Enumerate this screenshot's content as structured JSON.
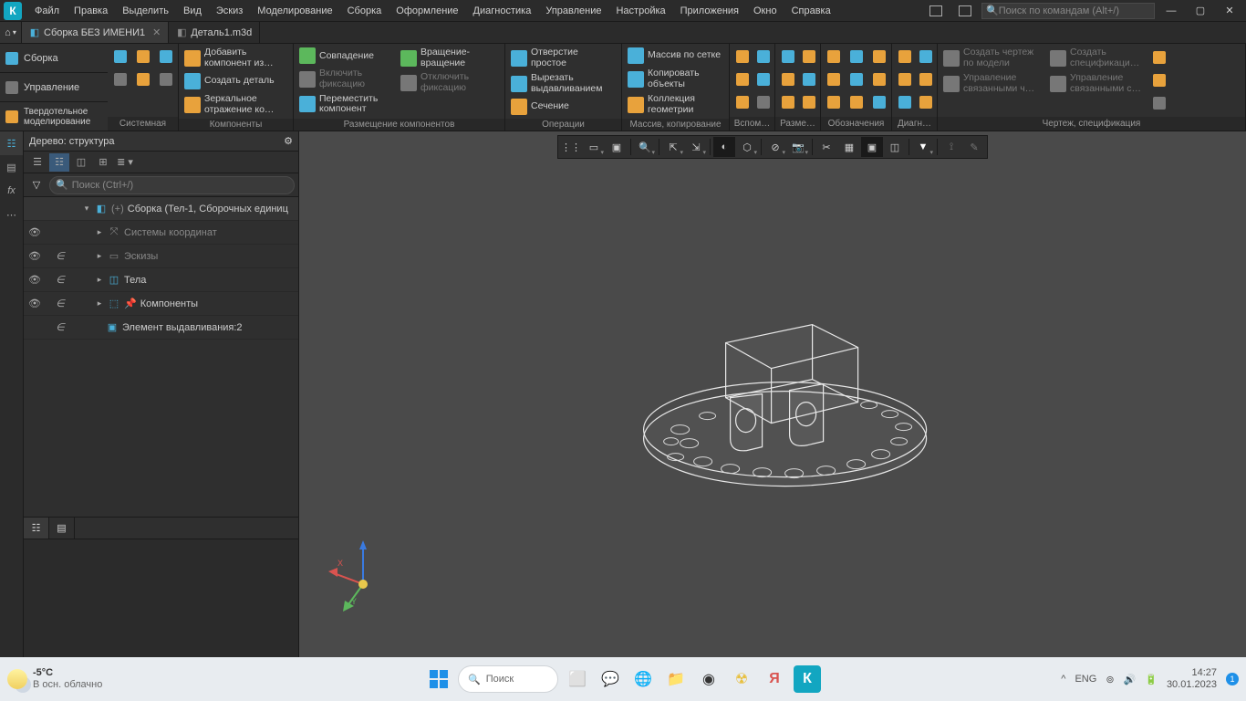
{
  "menubar": {
    "items": [
      "Файл",
      "Правка",
      "Выделить",
      "Вид",
      "Эскиз",
      "Моделирование",
      "Сборка",
      "Оформление",
      "Диагностика",
      "Управление",
      "Настройка",
      "Приложения",
      "Окно",
      "Справка"
    ],
    "search_placeholder": "Поиск по командам (Alt+/)"
  },
  "tabs": {
    "active": "Сборка БЕЗ ИМЕНИ1",
    "inactive": "Деталь1.m3d"
  },
  "modes": {
    "m1": "Сборка",
    "m2": "Управление",
    "m3": "Твердотельное моделирование"
  },
  "ribbon": {
    "g_system": "Системная",
    "g_components": "Компоненты",
    "g_placement": "Размещение компонентов",
    "g_operations": "Операции",
    "g_array": "Массив, копирование",
    "g_aux": "Вспом…",
    "g_dim": "Разме…",
    "g_annot": "Обозначения",
    "g_diag": "Диагн…",
    "g_drawing": "Чертеж, спецификация",
    "comp": {
      "add": "Добавить компонент из…",
      "create": "Создать деталь",
      "mirror": "Зеркальное отражение ко…"
    },
    "place": {
      "coinc": "Совпадение",
      "enable_fix": "Включить фиксацию",
      "move": "Переместить компонент",
      "rot": "Вращение-вращение",
      "disable_fix": "Отключить фиксацию"
    },
    "ops": {
      "hole": "Отверстие простое",
      "cut": "Вырезать выдавливанием",
      "section": "Сечение"
    },
    "arr": {
      "grid": "Массив по сетке",
      "copy": "Копировать объекты",
      "coll": "Коллекция геометрии"
    },
    "draw": {
      "d1": "Создать чертеж по модели",
      "d2": "Управление связанными ч…",
      "d3": "Создать спецификаци…",
      "d4": "Управление связанными с…"
    }
  },
  "tree": {
    "title": "Дерево: структура",
    "search_placeholder": "Поиск (Ctrl+/)",
    "root": "Сборка (Тел-1, Сборочных единиц",
    "n1": "Системы координат",
    "n2": "Эскизы",
    "n3": "Тела",
    "n4": "Компоненты",
    "n5": "Элемент выдавливания:2"
  },
  "taskbar": {
    "temp": "-5°C",
    "cond": "В осн. облачно",
    "search": "Поиск",
    "lang": "ENG",
    "time": "14:27",
    "date": "30.01.2023",
    "notif": "1"
  }
}
